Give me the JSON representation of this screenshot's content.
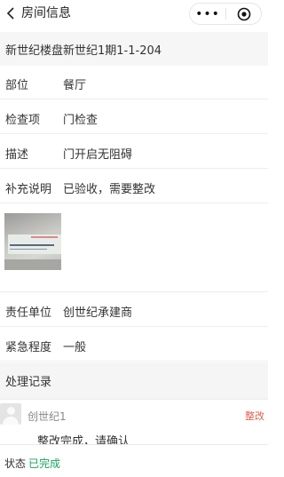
{
  "nav": {
    "title": "房间信息",
    "back_icon": "chevron-left-icon",
    "more_icon": "more-dots-icon",
    "close_icon": "target-circle-icon",
    "more_glyph": "•••"
  },
  "header": {
    "location": "新世纪楼盘新世纪1期1-1-204"
  },
  "fields": [
    {
      "label": "部位",
      "value": "餐厅"
    },
    {
      "label": "检查项",
      "value": "门检查"
    },
    {
      "label": "描述",
      "value": "门开启无阻碍"
    },
    {
      "label": "补充说明",
      "value": "已验收，需要整改"
    }
  ],
  "photo": {
    "icon": "photo-thumbnail"
  },
  "fields2": [
    {
      "label": "责任单位",
      "value": "创世纪承建商"
    },
    {
      "label": "紧急程度",
      "value": "一般"
    }
  ],
  "records": {
    "label": "处理记录",
    "items": [
      {
        "name": "创世纪1",
        "tag": "整改",
        "content": "整改完成，请确认"
      }
    ]
  },
  "status": {
    "label": "状态",
    "value": "已完成",
    "value_color": "#19a35a"
  }
}
